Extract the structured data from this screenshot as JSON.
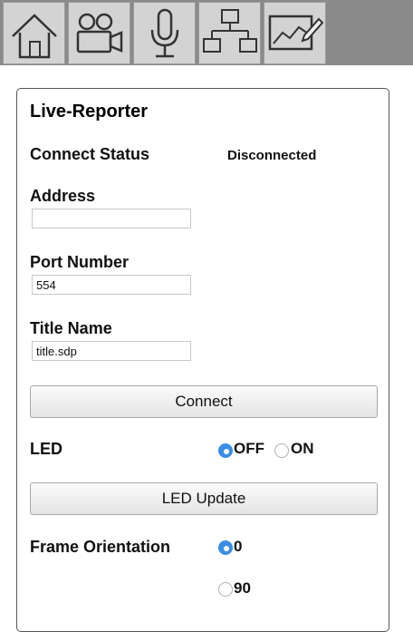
{
  "toolbar": {
    "items": [
      {
        "name": "home-icon"
      },
      {
        "name": "video-camera-icon"
      },
      {
        "name": "microphone-icon"
      },
      {
        "name": "network-icon"
      },
      {
        "name": "chart-edit-icon"
      }
    ]
  },
  "panel": {
    "title": "Live-Reporter",
    "connect_status": {
      "label": "Connect Status",
      "value": "Disconnected"
    },
    "address": {
      "label": "Address",
      "value": ""
    },
    "port": {
      "label": "Port Number",
      "value": "554"
    },
    "title_name": {
      "label": "Title Name",
      "value": "title.sdp"
    },
    "connect_button": "Connect",
    "led": {
      "label": "LED",
      "options": [
        "OFF",
        "ON"
      ],
      "selected": "OFF"
    },
    "led_update_button": "LED Update",
    "frame_orientation": {
      "label": "Frame Orientation",
      "options": [
        "0",
        "90"
      ],
      "selected": "0"
    }
  }
}
